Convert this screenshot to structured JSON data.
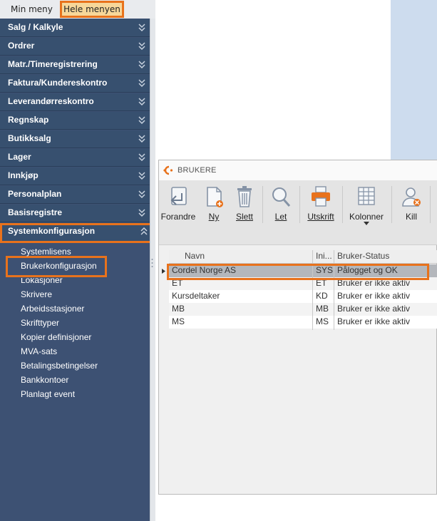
{
  "sidebar": {
    "tabs": {
      "min": "Min meny",
      "hele": "Hele menyen"
    },
    "sections": [
      {
        "label": "Salg / Kalkyle"
      },
      {
        "label": "Ordrer"
      },
      {
        "label": "Matr./Timeregistrering"
      },
      {
        "label": "Faktura/Kundereskontro"
      },
      {
        "label": "Leverandørreskontro"
      },
      {
        "label": "Regnskap"
      },
      {
        "label": "Butikksalg"
      },
      {
        "label": "Lager"
      },
      {
        "label": "Innkjøp"
      },
      {
        "label": "Personalplan"
      },
      {
        "label": "Basisregistre"
      },
      {
        "label": "Systemkonfigurasjon"
      }
    ],
    "sub_items": [
      "Systemlisens",
      "Brukerkonfigurasjon",
      "Lokasjoner",
      "Skrivere",
      "Arbeidsstasjoner",
      "Skrifttyper",
      "Kopier definisjoner",
      "MVA-sats",
      "Betalingsbetingelser",
      "Bankkontoer",
      "Planlagt event"
    ]
  },
  "window": {
    "title": "BRUKERE",
    "ribbon": {
      "forandre": "Forandre",
      "ny": "Ny",
      "slett": "Slett",
      "let": "Let",
      "utskrift": "Utskrift",
      "kolonner": "Kolonner",
      "kill": "Kill"
    },
    "columns": [
      "Navn",
      "Ini...",
      "Bruker-Status"
    ],
    "rows": [
      {
        "navn": "Cordel Norge AS",
        "ini": "SYS",
        "status": "Pålogget og OK"
      },
      {
        "navn": "ET",
        "ini": "ET",
        "status": "Bruker er ikke aktiv"
      },
      {
        "navn": "Kursdeltaker",
        "ini": "KD",
        "status": "Bruker er ikke aktiv"
      },
      {
        "navn": "MB",
        "ini": "MB",
        "status": "Bruker er ikke aktiv"
      },
      {
        "navn": "MS",
        "ini": "MS",
        "status": "Bruker er ikke aktiv"
      }
    ]
  },
  "colors": {
    "sidebar_bg": "#3d5173",
    "highlight": "#e8721c",
    "accent_orange": "#e8721c"
  },
  "icons": [
    "chevron-down-double-icon",
    "chevron-up-double-icon",
    "edit-icon",
    "new-document-icon",
    "trash-icon",
    "search-icon",
    "printer-icon",
    "columns-grid-icon",
    "kill-user-icon"
  ]
}
